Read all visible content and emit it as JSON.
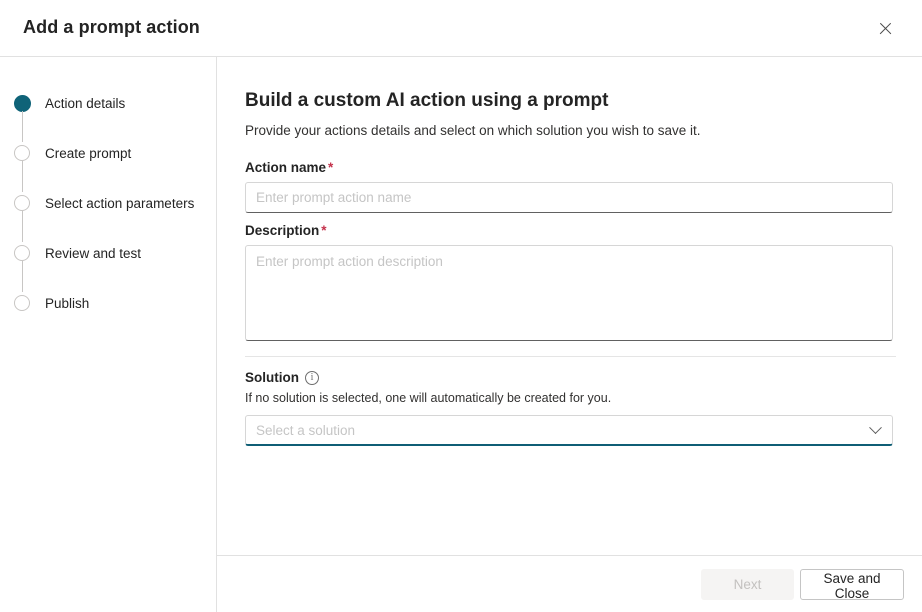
{
  "dialog": {
    "title": "Add a prompt action",
    "close_icon": "close-icon"
  },
  "sidebar": {
    "steps": [
      {
        "label": "Action details",
        "state": "active"
      },
      {
        "label": "Create prompt",
        "state": "pending"
      },
      {
        "label": "Select action parameters",
        "state": "pending"
      },
      {
        "label": "Review and test",
        "state": "pending"
      },
      {
        "label": "Publish",
        "state": "pending"
      }
    ]
  },
  "main": {
    "heading": "Build a custom AI action using a prompt",
    "subheading": "Provide your actions details and select on which solution you wish to save it.",
    "fields": {
      "action_name": {
        "label": "Action name",
        "required_marker": "*",
        "value": "",
        "placeholder": "Enter prompt action name"
      },
      "description": {
        "label": "Description",
        "required_marker": "*",
        "value": "",
        "placeholder": "Enter prompt action description"
      },
      "solution": {
        "label": "Solution",
        "info_icon": "info-icon",
        "info_glyph": "i",
        "hint": "If no solution is selected, one will automatically be created for you.",
        "value": "",
        "placeholder": "Select a solution",
        "caret_icon": "chevron-down-icon"
      }
    }
  },
  "footer": {
    "next_label": "Next",
    "save_close_label": "Save and Close"
  },
  "colors": {
    "accent_teal": "#0f6378",
    "focus_underline": "#0f5e75",
    "required_red": "#c4314b",
    "border_grey": "#e1e1e1",
    "disabled_text": "#c3c1bf"
  }
}
